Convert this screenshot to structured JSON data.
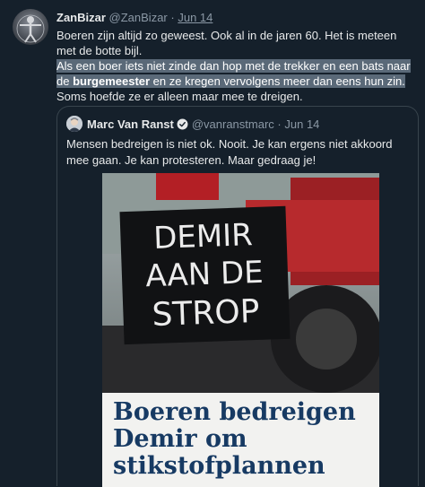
{
  "tweet": {
    "author_name": "ZanBizar",
    "author_handle": "@ZanBizar",
    "separator": "·",
    "date": "Jun 14",
    "line1": "Boeren zijn altijd zo geweest. Ook al in de jaren 60. Het is meteen met de botte bijl.",
    "hl_part1": "Als een boer iets niet zinde dan hop met de trekker en een bats naar de ",
    "hl_bold": "burgemeester",
    "hl_part2": " en ze kregen vervolgens meer dan eens hun zin.",
    "line3": "Soms hoefde ze er alleen maar mee te dreigen."
  },
  "quoted": {
    "author_name": "Marc Van Ranst",
    "author_handle": "@vanranstmarc",
    "separator": "·",
    "date": "Jun 14",
    "text": "Mensen bedreigen is niet ok. Nooit. Je kan ergens niet akkoord mee gaan. Je kan protesteren. Maar gedraag je!",
    "sign_text": [
      "DEMIR",
      "AAN DE",
      "STROP"
    ],
    "headline": "Boeren bedreigen Demir om stikstofplannen"
  },
  "colors": {
    "background": "#15202b",
    "text": "#e7e9ea",
    "muted": "#8b98a5",
    "highlight": "#5a6978",
    "verified": "#1d9bf0",
    "headline": "#173a63"
  },
  "icons": {
    "verified": "verified-badge-icon"
  }
}
